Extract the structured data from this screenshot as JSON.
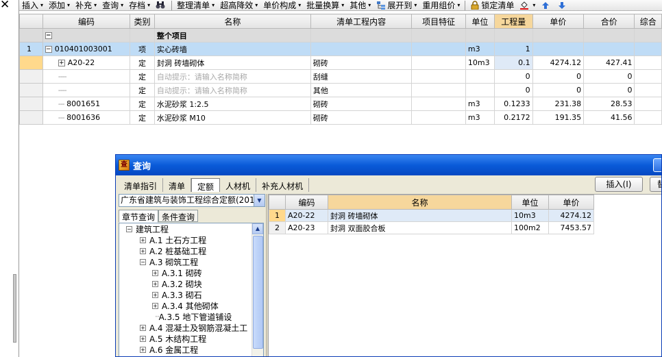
{
  "toolbar": {
    "left_glyph": "✕",
    "items": [
      {
        "label": "插入",
        "arrow": "▾"
      },
      {
        "label": "添加",
        "arrow": "▾"
      },
      {
        "label": "补充",
        "arrow": "▾"
      },
      {
        "label": "查询",
        "arrow": "▾"
      },
      {
        "label": "存档",
        "arrow": "▾"
      },
      {
        "label": "整理清单",
        "arrow": "▾"
      },
      {
        "label": "超高降效",
        "arrow": "▾"
      },
      {
        "label": "单价构成",
        "arrow": "▾"
      },
      {
        "label": "批量换算",
        "arrow": "▾"
      },
      {
        "label": "其他",
        "arrow": "▾"
      },
      {
        "label": "展开到",
        "arrow": "▾"
      },
      {
        "label": "重用组价",
        "arrow": "▾"
      },
      {
        "label": "锁定清单",
        "arrow": ""
      }
    ]
  },
  "main_grid": {
    "columns": [
      "编码",
      "类别",
      "名称",
      "清单工程内容",
      "项目特征",
      "单位",
      "工程量",
      "单价",
      "合价",
      "综合"
    ],
    "rows": [
      {
        "num": "",
        "toggle": "−",
        "code": "",
        "type": "",
        "name": "整个项目",
        "content": "",
        "feature": "",
        "unit": "",
        "qty": "",
        "price": "",
        "total": ""
      },
      {
        "num": "1",
        "toggle": "−",
        "code": "010401003001",
        "type": "项",
        "name": "实心砖墙",
        "content": "",
        "feature": "",
        "unit": "m3",
        "qty": "1",
        "price": "",
        "total": ""
      },
      {
        "num": "",
        "toggle": "+",
        "code": "A20-22",
        "type": "定",
        "name": "封洞 砖墙砌体",
        "content": "砌砖",
        "feature": "",
        "unit": "10m3",
        "qty": "0.1",
        "price": "4274.12",
        "total": "427.41"
      },
      {
        "num": "",
        "toggle": "",
        "code": "",
        "type": "定",
        "name": "自动提示：请输入名称简称",
        "content": "刮缝",
        "feature": "",
        "unit": "",
        "qty": "0",
        "price": "0",
        "total": "0"
      },
      {
        "num": "",
        "toggle": "",
        "code": "",
        "type": "定",
        "name": "自动提示：请输入名称简称",
        "content": "其他",
        "feature": "",
        "unit": "",
        "qty": "0",
        "price": "0",
        "total": "0"
      },
      {
        "num": "",
        "toggle": "",
        "code": "8001651",
        "type": "定",
        "name": "水泥砂浆 1:2.5",
        "content": "砌砖",
        "feature": "",
        "unit": "m3",
        "qty": "0.1233",
        "price": "231.38",
        "total": "28.53"
      },
      {
        "num": "",
        "toggle": "",
        "code": "8001636",
        "type": "定",
        "name": "水泥砂浆 M10",
        "content": "砌砖",
        "feature": "",
        "unit": "m3",
        "qty": "0.2172",
        "price": "191.35",
        "total": "41.56"
      }
    ]
  },
  "query_dialog": {
    "title": "查询",
    "title_icon": "查",
    "tabs": [
      "清单指引",
      "清单",
      "定额",
      "人材机",
      "补充人材机"
    ],
    "active_tab": "定额",
    "insert_button": "插入(I)",
    "more_button": "替",
    "quota_library": "广东省建筑与装饰工程综合定额(201",
    "select_arrow": "▼",
    "sub_tabs": [
      "章节查询",
      "条件查询"
    ],
    "scroll_up": "▲",
    "tree": [
      {
        "level": 0,
        "toggle": "−",
        "label": "建筑工程"
      },
      {
        "level": 1,
        "toggle": "+",
        "label": "A.1 土石方工程"
      },
      {
        "level": 1,
        "toggle": "+",
        "label": "A.2 桩基础工程"
      },
      {
        "level": 1,
        "toggle": "−",
        "label": "A.3 砌筑工程"
      },
      {
        "level": 2,
        "toggle": "+",
        "label": "A.3.1 砌砖"
      },
      {
        "level": 2,
        "toggle": "+",
        "label": "A.3.2 砌块"
      },
      {
        "level": 2,
        "toggle": "+",
        "label": "A.3.3 砌石"
      },
      {
        "level": 2,
        "toggle": "+",
        "label": "A.3.4 其他砌体"
      },
      {
        "level": 2,
        "toggle": "",
        "label": "A.3.5 地下管道铺设"
      },
      {
        "level": 1,
        "toggle": "+",
        "label": "A.4 混凝土及钢筋混凝土工"
      },
      {
        "level": 1,
        "toggle": "+",
        "label": "A.5 木结构工程"
      },
      {
        "level": 1,
        "toggle": "+",
        "label": "A.6 金属工程"
      }
    ],
    "result_grid": {
      "columns": [
        "编码",
        "名称",
        "单位",
        "单价"
      ],
      "rows": [
        {
          "num": "1",
          "code": "A20-22",
          "name": "封洞 砖墙砌体",
          "unit": "10m3",
          "price": "4274.12"
        },
        {
          "num": "2",
          "code": "A20-23",
          "name": "封洞 双面胶合板",
          "unit": "100m2",
          "price": "7453.57"
        }
      ]
    }
  },
  "colors": {
    "selected_row": "#bfdcf6",
    "header_highlight": "#f6d79c",
    "title_bar": "#0a5bd9",
    "dialog_bg": "#ece9d8"
  }
}
